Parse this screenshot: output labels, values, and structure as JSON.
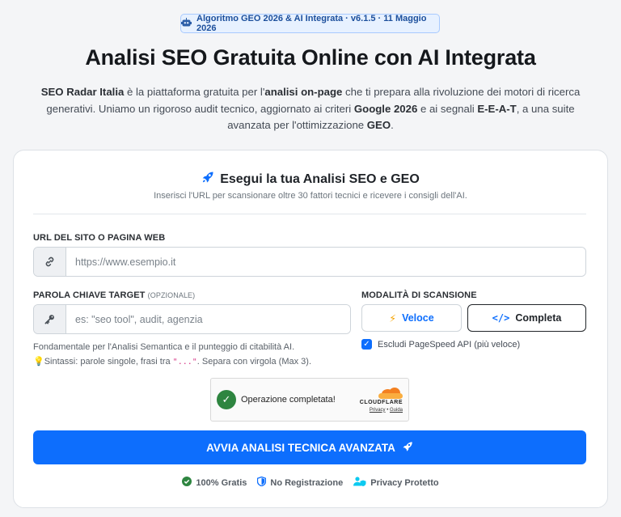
{
  "badge": {
    "icon": "robot-icon",
    "text": "Algoritmo GEO 2026 & AI Integrata · v6.1.5 · 11 Maggio 2026"
  },
  "hero": {
    "title": "Analisi SEO Gratuita Online con AI Integrata",
    "intro": {
      "brand": "SEO Radar Italia",
      "t1": " è la piattaforma gratuita per l'",
      "b1": "analisi on-page",
      "t2": " che ti prepara alla rivoluzione dei motori di ricerca generativi. Uniamo un rigoroso audit tecnico, aggiornato ai criteri ",
      "b2": "Google 2026",
      "t3": " e ai segnali ",
      "b3": "E-E-A-T",
      "t4": ", a una suite avanzata per l'ottimizzazione ",
      "b4": "GEO",
      "t5": "."
    }
  },
  "form": {
    "title": "Esegui la tua Analisi SEO e GEO",
    "subtitle": "Inserisci l'URL per scansionare oltre 30 fattori tecnici e ricevere i consigli dell'AI.",
    "url": {
      "label": "URL DEL SITO O PAGINA WEB",
      "placeholder": "https://www.esempio.it",
      "value": ""
    },
    "keyword": {
      "label": "PAROLA CHIAVE TARGET",
      "optional": "(OPZIONALE)",
      "placeholder": "es: \"seo tool\", audit, agenzia",
      "value": "",
      "help1": "Fondamentale per l'Analisi Semantica e il punteggio di citabilità AI.",
      "help2a": "Sintassi: parole singole, frasi tra ",
      "help2code": "\"...\"",
      "help2b": ". Separa con virgola (Max 3)."
    },
    "mode": {
      "label": "MODALITÀ DI SCANSIONE",
      "options": [
        "Veloce",
        "Completa"
      ],
      "selected": "Completa"
    },
    "pagespeed": {
      "label": "Escludi PageSpeed API (più veloce)",
      "checked": true
    },
    "captcha": {
      "status": "Operazione completata!",
      "brand": "CLOUDFLARE",
      "privacy": "Privacy",
      "sep": "•",
      "guide": "Guida"
    },
    "submit": "AVVIA ANALISI TECNICA AVANZATA"
  },
  "trust": [
    {
      "icon": "check-circle-icon",
      "label": "100% Gratis",
      "color": "#2e8540"
    },
    {
      "icon": "shield-icon",
      "label": "No Registrazione",
      "color": "#0d6efd"
    },
    {
      "icon": "user-shield-icon",
      "label": "Privacy Protetto",
      "color": "#0dcaf0"
    }
  ],
  "colors": {
    "primary": "#0d6efd",
    "success": "#2e8540",
    "cloudflare": "#f38020"
  }
}
